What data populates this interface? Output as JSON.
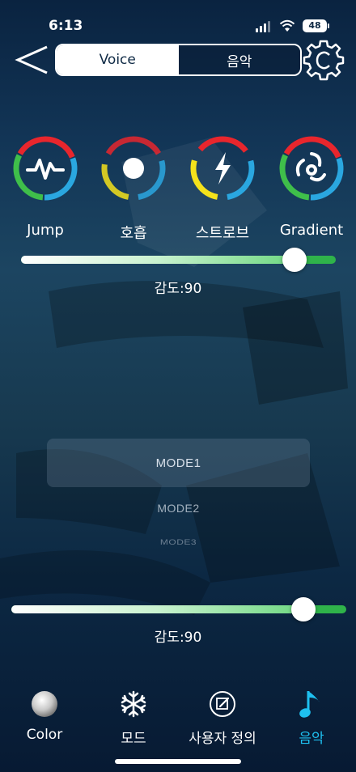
{
  "status_bar": {
    "time": "6:13",
    "battery": "48"
  },
  "header": {
    "tabs": [
      {
        "label": "Voice",
        "active": true
      },
      {
        "label": "음악",
        "active": false
      }
    ]
  },
  "effects": [
    {
      "label": "Jump",
      "icon": "pulse-icon"
    },
    {
      "label": "호흡",
      "icon": "dot-icon"
    },
    {
      "label": "스트로브",
      "icon": "lightning-icon"
    },
    {
      "label": "Gradient",
      "icon": "swirl-icon"
    }
  ],
  "slider_top": {
    "value": 90,
    "max": 100,
    "label": "감도:90"
  },
  "modes": {
    "items": [
      "MODE1",
      "MODE2",
      "MODE3"
    ],
    "selected": "MODE1"
  },
  "slider_bottom": {
    "value": 90,
    "max": 100,
    "label": "감도:90"
  },
  "tab_bar": {
    "tabs": [
      {
        "label": "Color",
        "icon": "color-disc-icon",
        "active": false
      },
      {
        "label": "모드",
        "icon": "snowflake-icon",
        "active": false
      },
      {
        "label": "사용자 정의",
        "icon": "edit-icon",
        "active": false
      },
      {
        "label": "음악",
        "icon": "music-note-icon",
        "active": true
      }
    ]
  },
  "colors": {
    "accent": "#1ec0f0",
    "slider_green": "#2fb34a",
    "ring_red": "#e8262d",
    "ring_blue": "#2aa7e0",
    "ring_yellow": "#f5e21b",
    "ring_green": "#3fbf4a"
  }
}
